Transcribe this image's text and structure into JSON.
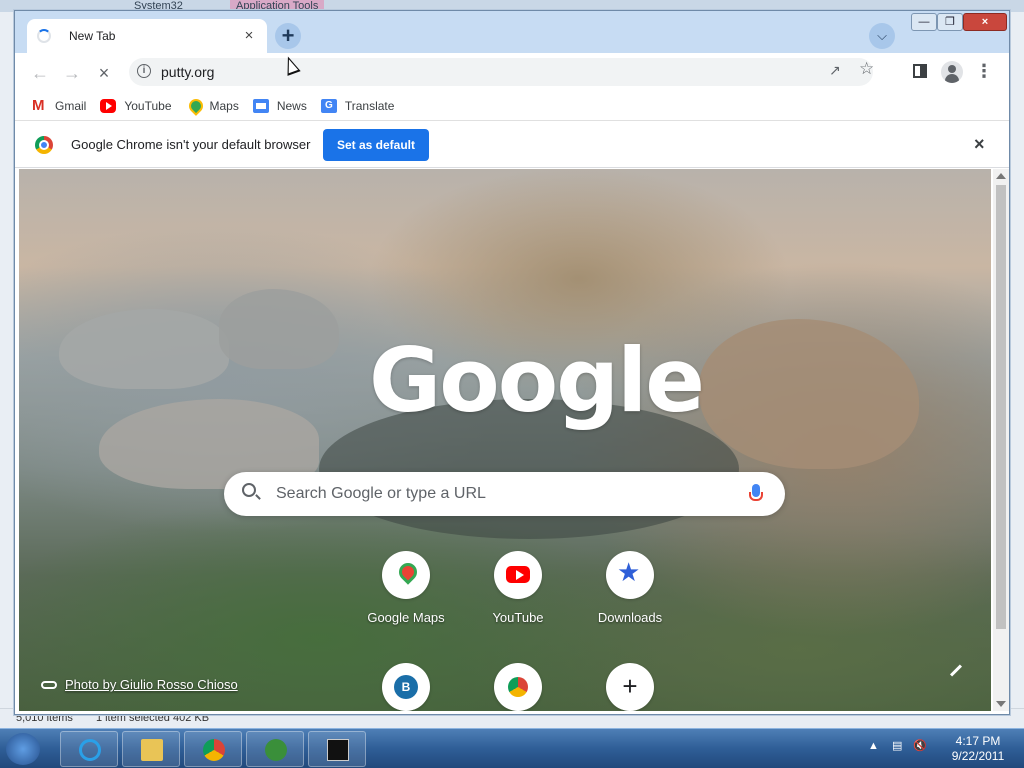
{
  "background": {
    "top_tabs": [
      "System32",
      "Application Tools"
    ],
    "status": {
      "items_count": "5,010 items",
      "selected": "1 item selected  402 KB"
    }
  },
  "window": {
    "tab": {
      "title": "New Tab"
    },
    "address": {
      "url": "putty.org"
    },
    "bookmarks": [
      {
        "label": "Gmail",
        "icon": "gmail-icon"
      },
      {
        "label": "YouTube",
        "icon": "youtube-icon"
      },
      {
        "label": "Maps",
        "icon": "maps-icon"
      },
      {
        "label": "News",
        "icon": "news-icon"
      },
      {
        "label": "Translate",
        "icon": "translate-icon"
      }
    ],
    "infobar": {
      "message": "Google Chrome isn't your default browser",
      "button": "Set as default"
    }
  },
  "ntp": {
    "logo": "Google",
    "search_placeholder": "Search Google or type a URL",
    "shortcuts": [
      {
        "label": "Google Maps",
        "icon": "google-maps-icon"
      },
      {
        "label": "YouTube",
        "icon": "youtube-icon"
      },
      {
        "label": "Downloads",
        "icon": "downloads-icon"
      },
      {
        "label": "",
        "icon": "b-icon",
        "letter": "B"
      },
      {
        "label": "",
        "icon": "chrome-icon"
      },
      {
        "label": "",
        "icon": "add-shortcut-icon"
      }
    ],
    "photo_credit": "Photo by Giulio Rosso Chioso"
  },
  "taskbar": {
    "time": "4:17 PM",
    "date": "9/22/2011"
  },
  "colors": {
    "accent": "#1a73e8",
    "titlebar": "#c7dcf3"
  }
}
